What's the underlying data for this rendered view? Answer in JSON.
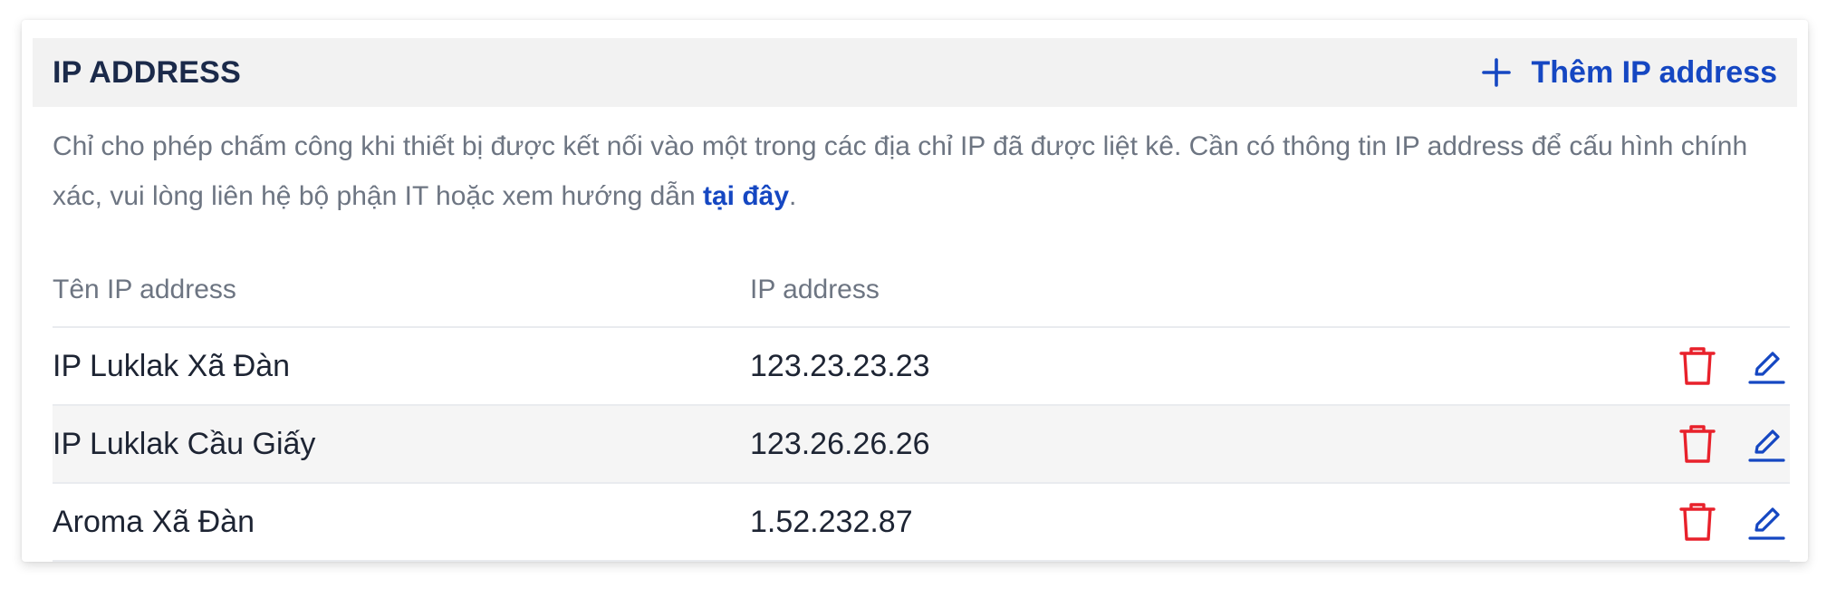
{
  "section": {
    "title": "IP ADDRESS",
    "add_label": "Thêm IP address"
  },
  "description": {
    "text": "Chỉ cho phép chấm công khi thiết bị được kết nối vào một trong các địa chỉ IP đã được liệt kê. Cần có thông tin IP address để cấu hình chính xác, vui lòng liên hệ bộ phận IT hoặc xem hướng dẫn ",
    "link_text": "tại đây",
    "suffix": "."
  },
  "table": {
    "columns": [
      "Tên IP address",
      "IP address"
    ],
    "rows": [
      {
        "name": "IP Luklak Xã Đàn",
        "ip": "123.23.23.23"
      },
      {
        "name": "IP Luklak Cầu Giấy",
        "ip": "123.26.26.26"
      },
      {
        "name": "Aroma Xã Đàn",
        "ip": "1.52.232.87"
      }
    ]
  },
  "icons": {
    "add": "plus-icon",
    "delete": "trash-icon",
    "edit": "pencil-icon"
  },
  "colors": {
    "accent": "#1547c2",
    "danger": "#e8212b",
    "header_bg": "#f2f2f2",
    "muted_text": "#6d7582"
  }
}
